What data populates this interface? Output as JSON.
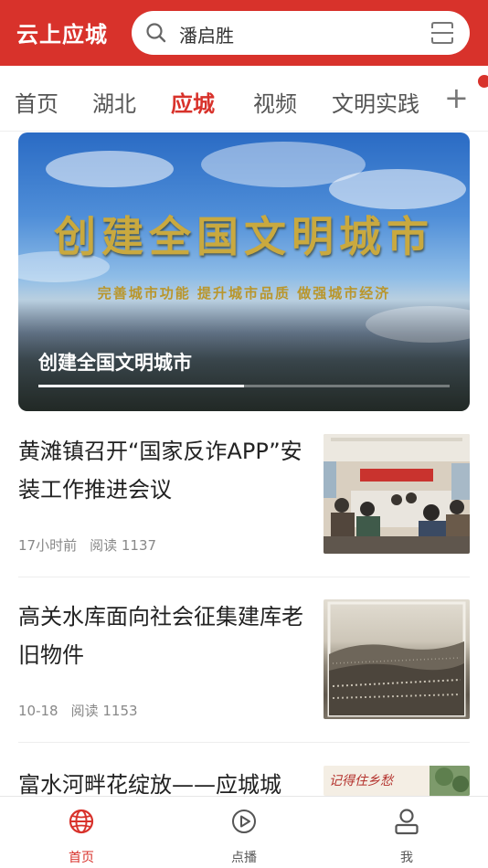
{
  "header": {
    "app_title": "云上应城",
    "search_text": "潘启胜",
    "icons": [
      "search-icon",
      "scan-icon"
    ]
  },
  "tabs": [
    {
      "label": "首页",
      "active": false
    },
    {
      "label": "湖北",
      "active": false
    },
    {
      "label": "应城",
      "active": true
    },
    {
      "label": "视频",
      "active": false
    },
    {
      "label": "文明实践",
      "active": false
    }
  ],
  "tabs_add_label": "+",
  "banner": {
    "image_text": "创建全国文明城市",
    "image_slogan": "完善城市功能  提升城市品质  做强城市经济",
    "caption": "创建全国文明城市",
    "progress": 0.5
  },
  "news": [
    {
      "title": "黄滩镇召开“国家反诈APP”安装工作推进会议",
      "time": "17小时前",
      "reads": "阅读 1137",
      "thumb": "meeting-photo"
    },
    {
      "title": "高关水库面向社会征集建库老旧物件",
      "time": "10-18",
      "reads": "阅读 1153",
      "thumb": "archive-photo"
    },
    {
      "title": "富水河畔花绽放——应城城",
      "thumb": "poster-photo",
      "thumb_text": "记得住乡愁"
    }
  ],
  "bottom_nav": [
    {
      "label": "首页",
      "icon": "globe-icon",
      "active": true
    },
    {
      "label": "点播",
      "icon": "play-circle-icon",
      "active": false
    },
    {
      "label": "我",
      "icon": "user-icon",
      "active": false
    }
  ],
  "colors": {
    "brand": "#d8322b",
    "text": "#222222",
    "meta": "#888888"
  }
}
